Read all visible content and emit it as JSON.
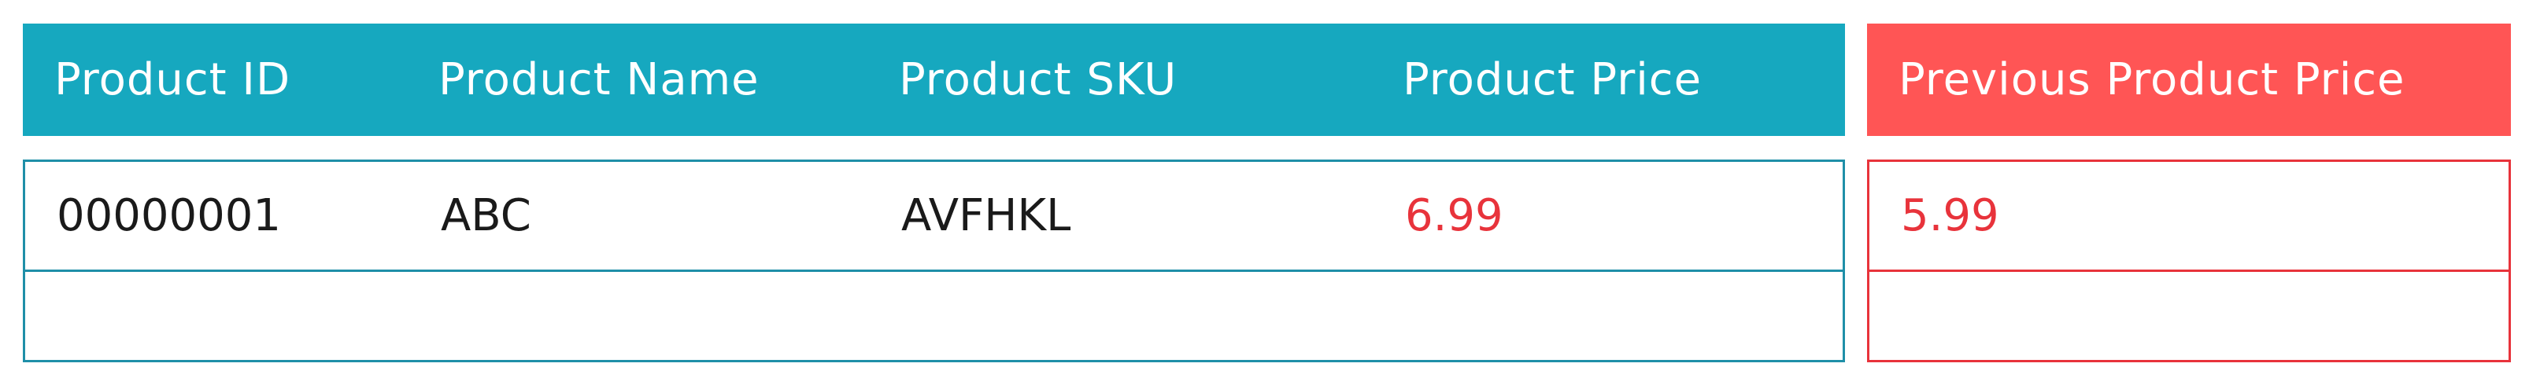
{
  "colors": {
    "header_primary": "#16A8BF",
    "header_previous": "#FF5555",
    "border_primary": "#1F8FA8",
    "border_previous": "#E8333B",
    "price_text": "#E8333B",
    "body_text": "#1a1a1a",
    "header_text": "#FFFFFF"
  },
  "header": {
    "product_id": "Product ID",
    "product_name": "Product Name",
    "product_sku": "Product SKU",
    "product_price": "Product Price",
    "previous_product_price": "Previous Product Price"
  },
  "rows": [
    {
      "product_id": "00000001",
      "product_name": "ABC",
      "product_sku": "AVFHKL",
      "product_price": "6.99",
      "previous_product_price": "5.99"
    }
  ]
}
